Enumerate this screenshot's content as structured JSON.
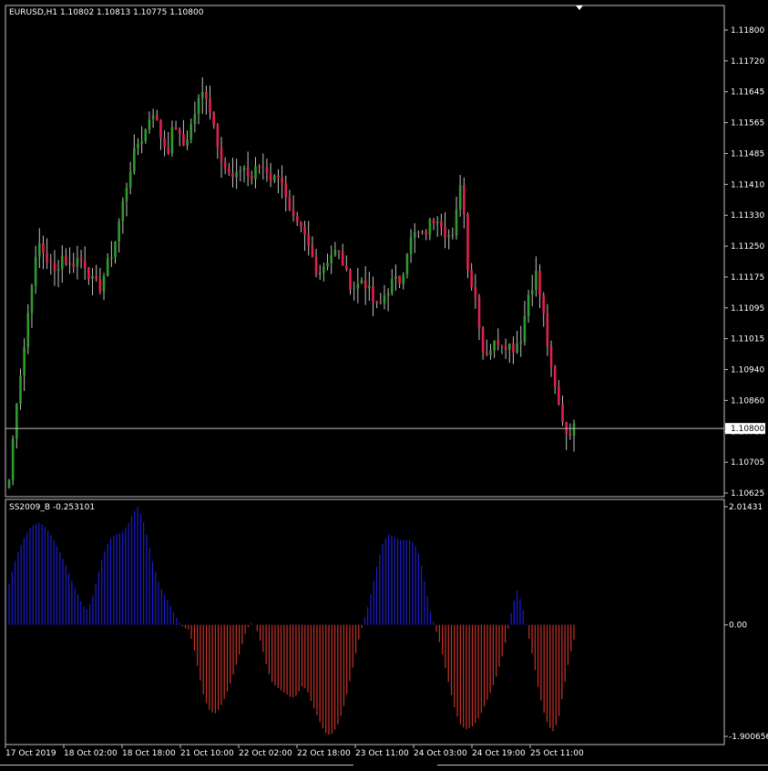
{
  "colors": {
    "background": "#000000",
    "frame": "#c0c0c0",
    "bull_candle": "#2e9b2e",
    "bear_candle": "#e0204f",
    "wick": "#c0c0c0",
    "price_line": "#c0c0c0",
    "osc_positive": "#1b1bd0",
    "osc_negative": "#c8322a",
    "current_label_bg": "#ffffff",
    "current_label_text": "#000000"
  },
  "price_panel": {
    "title": "EURUSD,H1  1.10802 1.10813 1.10775 1.10800",
    "current_price_label": "1.10800"
  },
  "osc_panel": {
    "title": "SS2009_B -0.253101"
  },
  "chart_data": [
    {
      "type": "candlestick",
      "symbol": "EURUSD",
      "timeframe": "H1",
      "current_price": 1.108,
      "ylim": [
        1.10625,
        1.1188
      ],
      "y_ticks": [
        "1.11800",
        "1.11720",
        "1.11645",
        "1.11565",
        "1.11485",
        "1.11410",
        "1.11330",
        "1.11250",
        "1.11175",
        "1.11095",
        "1.11015",
        "1.10940",
        "1.10860",
        "1.10780",
        "1.10705",
        "1.10625"
      ],
      "x_ticks": [
        "17 Oct 2019",
        "18 Oct 02:00",
        "18 Oct 18:00",
        "21 Oct 10:00",
        "22 Oct 02:00",
        "22 Oct 18:00",
        "23 Oct 11:00",
        "24 Oct 03:00",
        "24 Oct 19:00",
        "25 Oct 11:00"
      ],
      "close_path": [
        1.1066,
        1.1088,
        1.1102,
        1.112,
        1.113,
        1.1126,
        1.1122,
        1.1127,
        1.1124,
        1.1126,
        1.1125,
        1.112,
        1.1118,
        1.1124,
        1.113,
        1.114,
        1.115,
        1.1157,
        1.116,
        1.1167,
        1.116,
        1.1155,
        1.1163,
        1.1156,
        1.1161,
        1.1168,
        1.1172,
        1.1164,
        1.1155,
        1.1149,
        1.1147,
        1.1152,
        1.1147,
        1.1151,
        1.1151,
        1.1147,
        1.115,
        1.1139,
        1.1135,
        1.1133,
        1.1128,
        1.1122,
        1.1125,
        1.1128,
        1.1127,
        1.112,
        1.1118,
        1.1121,
        1.1116,
        1.1112,
        1.1117,
        1.112,
        1.112,
        1.113,
        1.1133,
        1.1132,
        1.1136,
        1.1138,
        1.1133,
        1.1131,
        1.1149,
        1.1122,
        1.1115,
        1.11,
        1.1102,
        1.1104,
        1.1103,
        1.1102,
        1.1105,
        1.1117,
        1.1122,
        1.111,
        1.1095,
        1.1086,
        1.1079,
        1.108
      ],
      "oscillator": {
        "name": "SS2009_B",
        "value": -0.253101,
        "ylim": [
          -1.900656,
          2.01431
        ],
        "y_ticks": [
          "2.01431",
          "0.00",
          "-1.900656"
        ],
        "values": [
          0.7,
          1.05,
          1.3,
          1.5,
          1.65,
          1.72,
          1.75,
          1.67,
          1.55,
          1.4,
          1.22,
          1.02,
          0.8,
          0.6,
          0.4,
          0.25,
          0.4,
          0.75,
          1.1,
          1.35,
          1.5,
          1.55,
          1.58,
          1.68,
          1.88,
          2.01,
          1.82,
          1.45,
          1.05,
          0.75,
          0.55,
          0.4,
          0.22,
          0.05,
          -0.05,
          -0.08,
          -0.4,
          -0.85,
          -1.25,
          -1.45,
          -1.52,
          -1.42,
          -1.25,
          -1.02,
          -0.75,
          -0.45,
          -0.15,
          0.05,
          -0.02,
          -0.3,
          -0.65,
          -0.95,
          -1.05,
          -1.12,
          -1.18,
          -1.25,
          -1.2,
          -1.05,
          -1.1,
          -1.35,
          -1.55,
          -1.75,
          -1.88,
          -1.85,
          -1.7,
          -1.45,
          -1.1,
          -0.7,
          -0.28,
          0.05,
          0.35,
          0.75,
          1.15,
          1.45,
          1.55,
          1.5,
          1.45,
          1.45,
          1.45,
          1.38,
          1.15,
          0.7,
          0.25,
          -0.05,
          -0.35,
          -0.75,
          -1.15,
          -1.5,
          -1.72,
          -1.78,
          -1.75,
          -1.65,
          -1.5,
          -1.3,
          -1.1,
          -0.85,
          -0.55,
          -0.15,
          0.3,
          0.6,
          0.3,
          -0.12,
          -0.55,
          -1.05,
          -1.45,
          -1.72,
          -1.82,
          -1.6,
          -1.1,
          -0.6,
          -0.25
        ]
      }
    }
  ]
}
